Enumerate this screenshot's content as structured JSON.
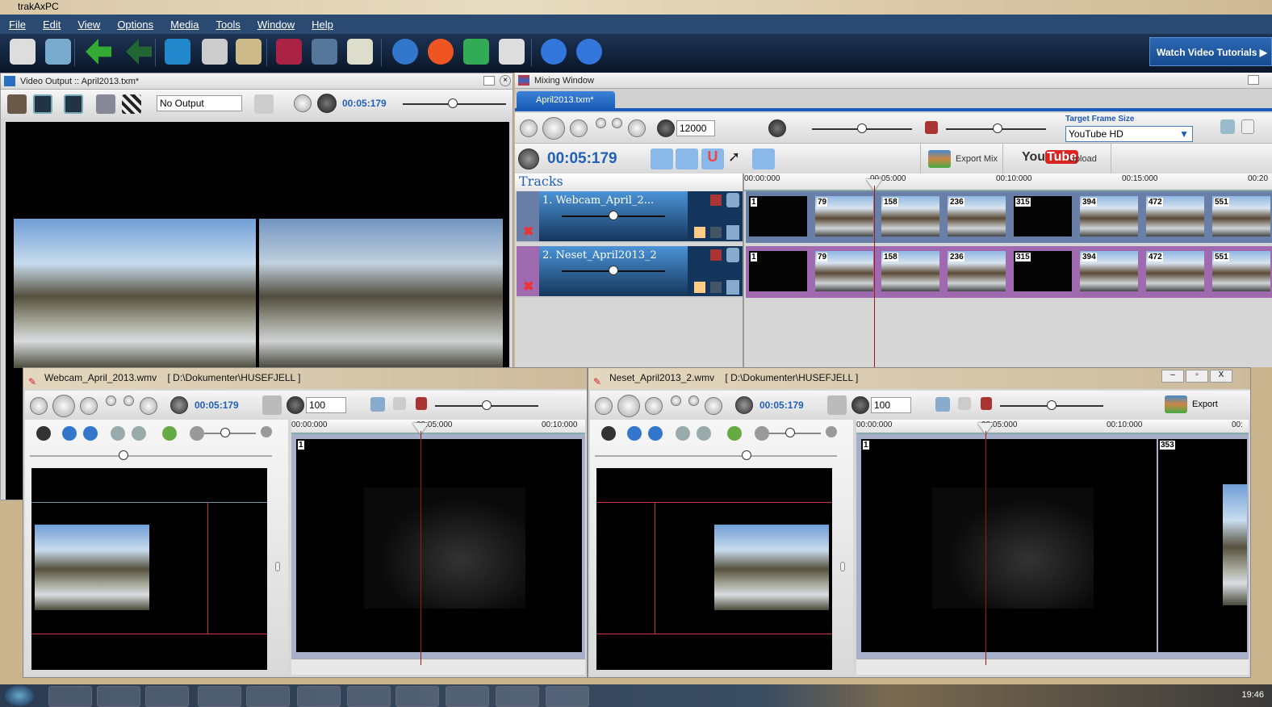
{
  "app": {
    "title": "trakAxPC"
  },
  "menu": [
    "File",
    "Edit",
    "View",
    "Options",
    "Media",
    "Tools",
    "Window",
    "Help"
  ],
  "toolbar": {
    "icons": [
      "save-icon",
      "open-folder-icon",
      "undo-arrow-icon",
      "redo-arrow-icon",
      "monitor-icon",
      "microphone-icon",
      "cd-burn-icon",
      "scissors-icon",
      "radar-icon",
      "tracks-list-icon",
      "globe-icon",
      "lifebuoy-icon",
      "audio-edit-icon",
      "presenter-icon",
      "help-icon",
      "info-icon"
    ],
    "tutorials": "Watch Video Tutorials"
  },
  "video_output": {
    "title": "Video Output :: April2013.txm*",
    "output_select": "No Output",
    "time": "00:05:179"
  },
  "mixing": {
    "title": "Mixing Window",
    "tab": "April2013.txm*",
    "speed": "12000",
    "time": "00:05:179",
    "target_frame_label": "Target Frame Size",
    "target_frame": "YouTube HD",
    "export_mix": "Export Mix",
    "youtube_logo": "YouTube",
    "upload": "Upload",
    "tracks_label": "Tracks",
    "ruler": [
      "00:00:000",
      "00:05:000",
      "00:10:000",
      "00:15:000",
      "00:20"
    ],
    "tracks": [
      {
        "name": "1. Webcam_April_2...",
        "color": "#6a7fa8",
        "frames": [
          "1",
          "79",
          "158",
          "236",
          "315",
          "394",
          "472",
          "551"
        ]
      },
      {
        "name": "2. Neset_April2013_2",
        "color": "#a06ab0",
        "frames": [
          "1",
          "79",
          "158",
          "236",
          "315",
          "394",
          "472",
          "551"
        ]
      }
    ]
  },
  "clip_windows": [
    {
      "file": "Webcam_April_2013.wmv",
      "path": "[ D:\\Dokumenter\\HUSEFJELL ]",
      "time": "00:05:179",
      "value": "100",
      "ruler": [
        "00:00:000",
        "00:05:000",
        "00:10:000"
      ],
      "frames": [
        "1"
      ]
    },
    {
      "file": "Neset_April2013_2.wmv",
      "path": "[ D:\\Dokumenter\\HUSEFJELL ]",
      "time": "00:05:179",
      "value": "100",
      "ruler": [
        "00:00:000",
        "00:05:000",
        "00:10:000",
        "00:"
      ],
      "frames": [
        "1",
        "353"
      ],
      "export": "Export"
    }
  ],
  "taskbar": {
    "clock": "19:46"
  }
}
